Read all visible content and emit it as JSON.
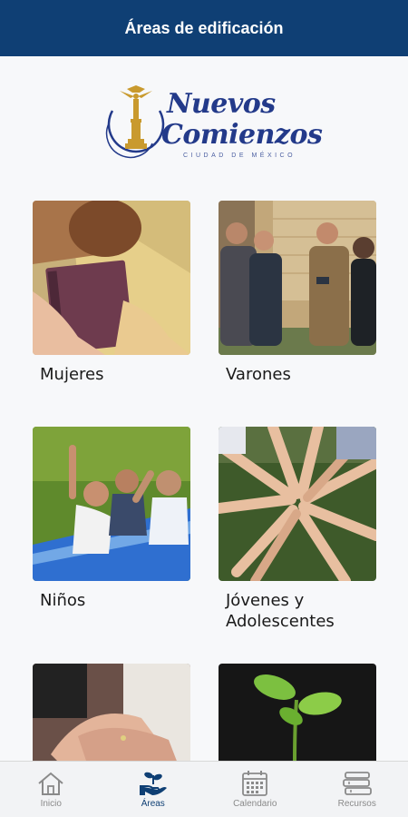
{
  "header": {
    "title": "Áreas de edificación"
  },
  "logo": {
    "line1": "Nuevos",
    "line2": "Comienzos",
    "line3": "CIUDAD DE MÉXICO"
  },
  "areas": [
    {
      "label": "Mujeres"
    },
    {
      "label": "Varones"
    },
    {
      "label": "Niños"
    },
    {
      "label": "Jóvenes y Adolescentes"
    },
    {
      "label": ""
    },
    {
      "label": ""
    }
  ],
  "tabbar": {
    "items": [
      {
        "label": "Inicio",
        "icon": "home-icon"
      },
      {
        "label": "Áreas",
        "icon": "hands-plant-icon",
        "active": true
      },
      {
        "label": "Calendario",
        "icon": "calendar-icon"
      },
      {
        "label": "Recursos",
        "icon": "books-icon"
      }
    ]
  },
  "colors": {
    "header": "#0f3f74",
    "brand": "#233a8a",
    "gold": "#c99a2e",
    "tab_inactive": "#8a8a8a"
  }
}
